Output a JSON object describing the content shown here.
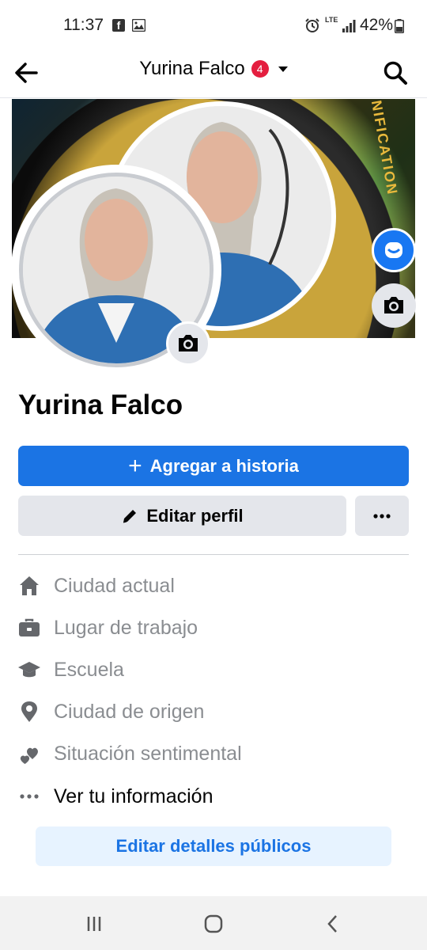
{
  "status_bar": {
    "time": "11:37",
    "network": "LTE",
    "battery": "42%"
  },
  "header": {
    "title": "Yurina Falco",
    "badge_count": "4"
  },
  "cover": {
    "text": "REUNIFICATION"
  },
  "profile": {
    "name": "Yurina Falco"
  },
  "actions": {
    "add_story_label": "Agregar a historia",
    "edit_profile_label": "Editar perfil"
  },
  "details": {
    "items": [
      {
        "label": "Ciudad actual",
        "icon": "home-icon"
      },
      {
        "label": "Lugar de trabajo",
        "icon": "briefcase-icon"
      },
      {
        "label": "Escuela",
        "icon": "graduation-cap-icon"
      },
      {
        "label": "Ciudad de origen",
        "icon": "location-pin-icon"
      },
      {
        "label": "Situación sentimental",
        "icon": "hearts-icon"
      },
      {
        "label": "Ver tu información",
        "icon": "more-horizontal-icon"
      }
    ],
    "edit_public_label": "Editar detalles públicos"
  },
  "colors": {
    "primary": "#1b74e4",
    "badge": "#e41e3f",
    "secondary_bg": "#e4e6eb",
    "muted_text": "#8a8d91"
  }
}
